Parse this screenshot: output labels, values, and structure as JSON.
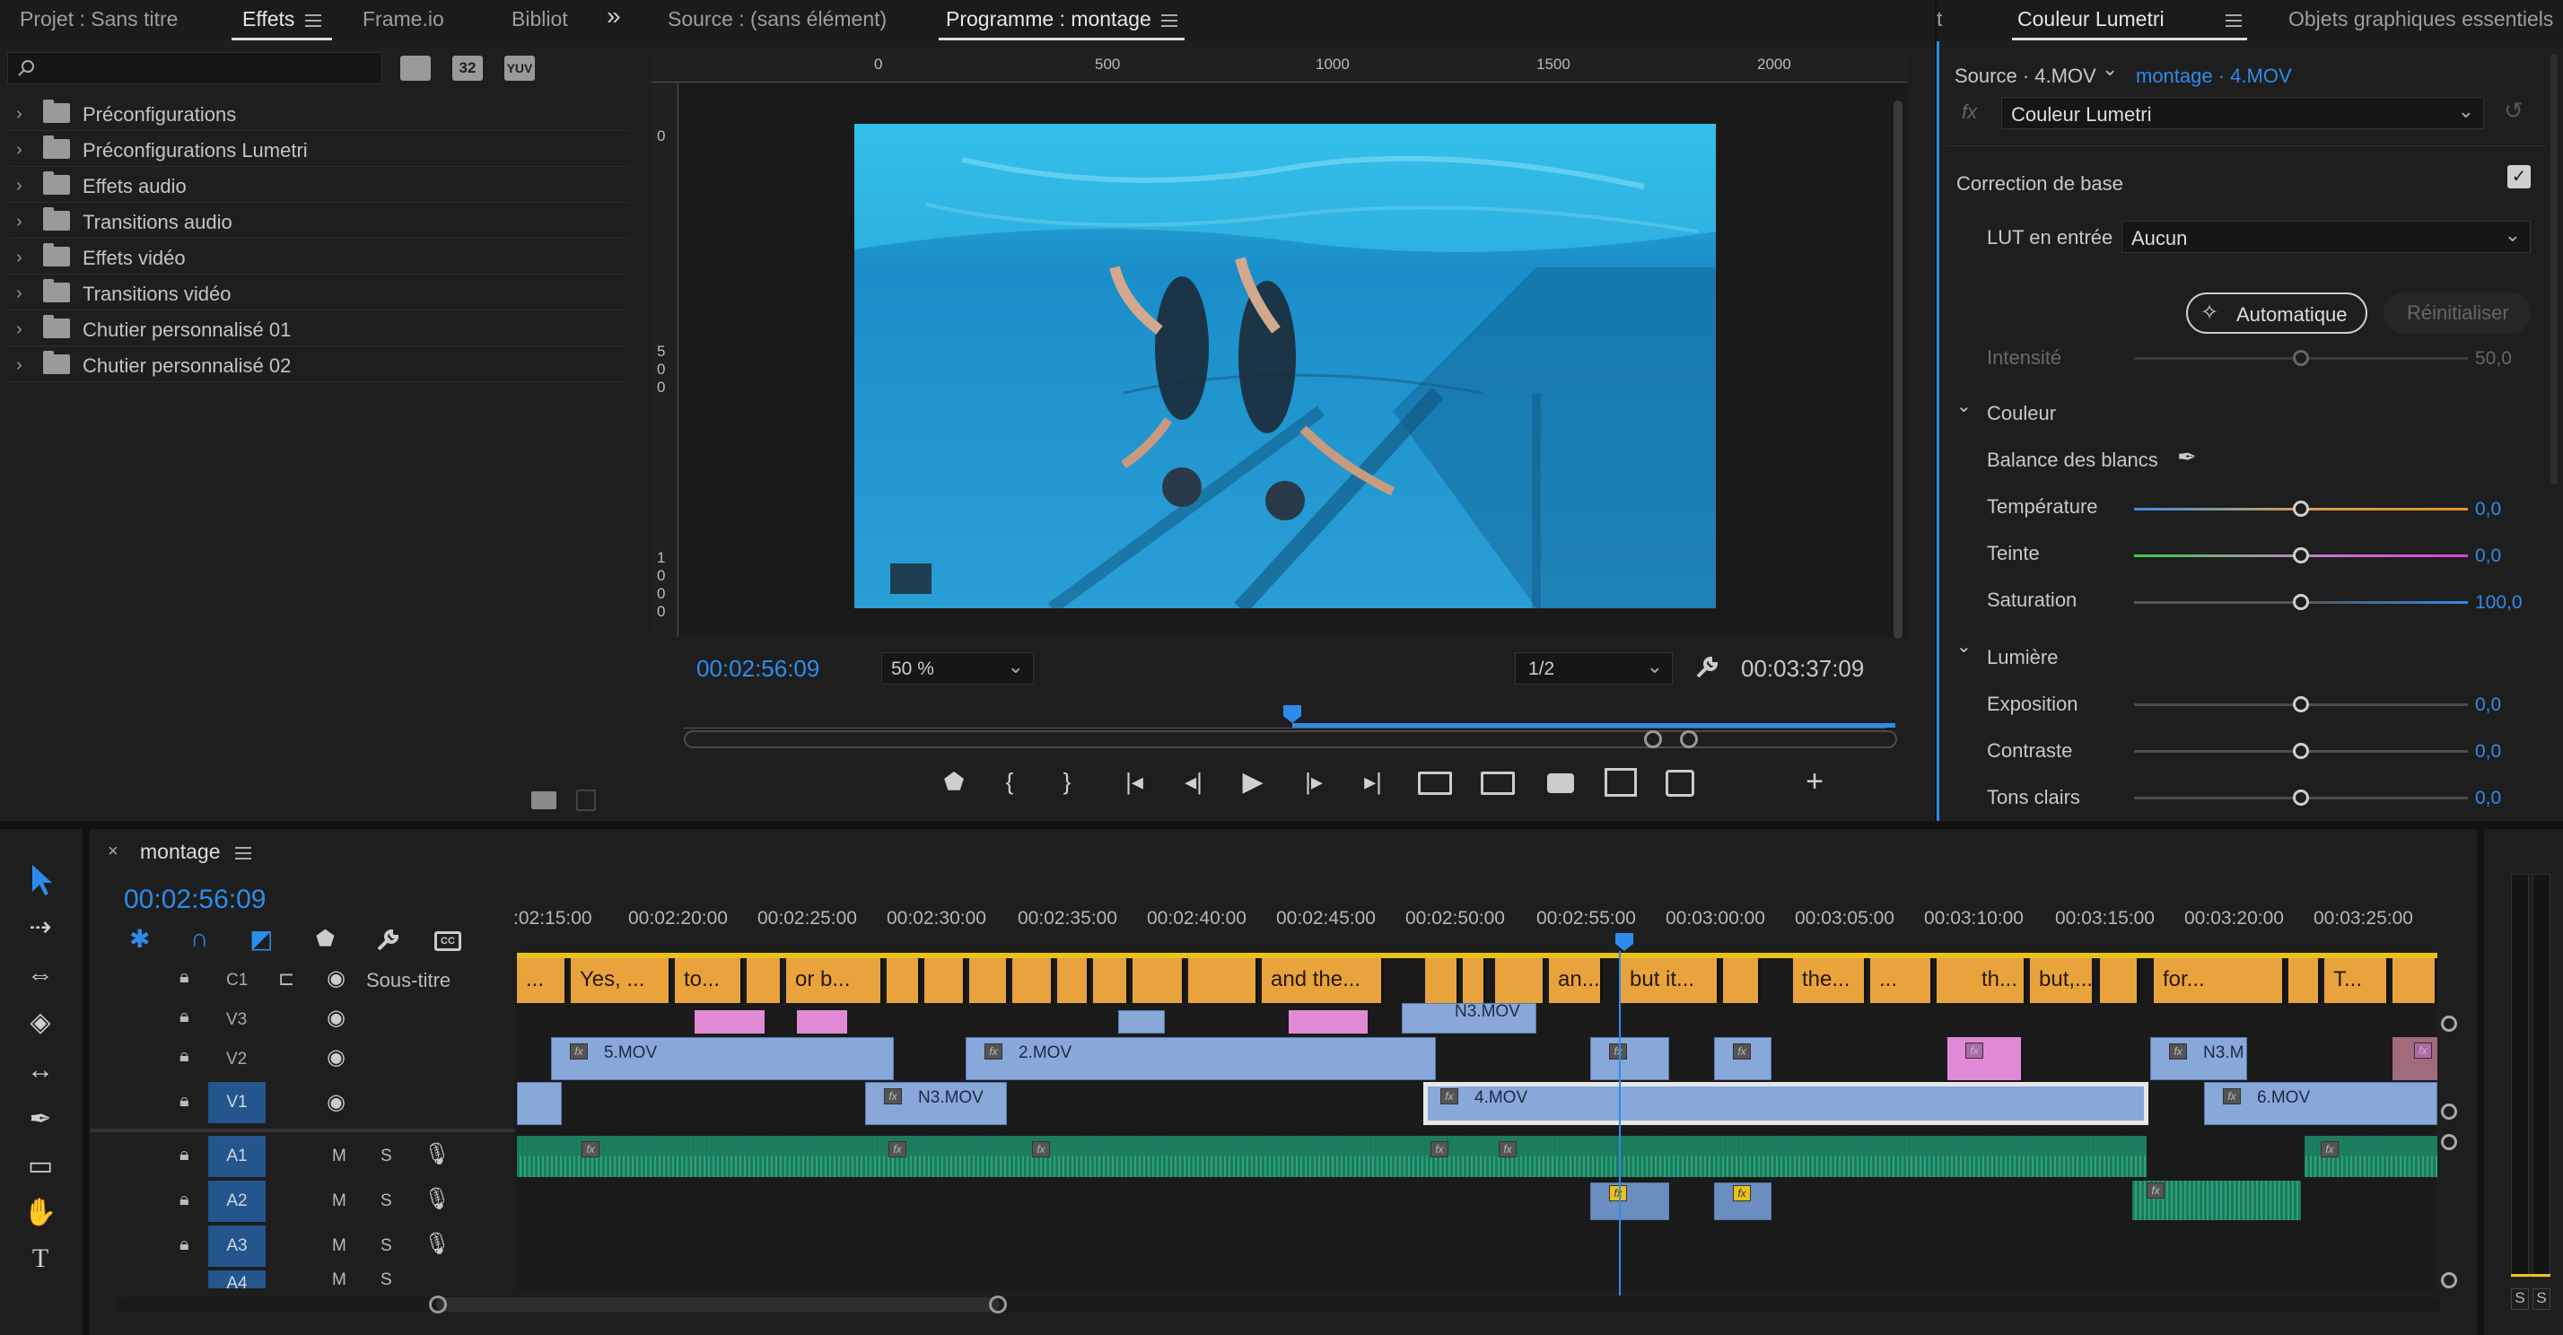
{
  "left_panel": {
    "tabs": [
      "Projet : Sans titre",
      "Effets",
      "Frame.io",
      "Bibliot"
    ],
    "active_tab": "Effets",
    "search_placeholder": "",
    "filter_icons": [
      "32",
      "YUV"
    ],
    "folders": [
      "Préconfigurations",
      "Préconfigurations Lumetri",
      "Effets audio",
      "Transitions audio",
      "Effets vidéo",
      "Transitions vidéo",
      "Chutier personnalisé 01",
      "Chutier personnalisé 02"
    ]
  },
  "monitor": {
    "source_tab": "Source : (sans élément)",
    "program_tab": "Programme : montage",
    "ruler_top": [
      "0",
      "500",
      "1000",
      "1500",
      "2000"
    ],
    "ruler_left": [
      "0",
      "5\n0\n0",
      "1\n0\n0\n0"
    ],
    "current_tc": "00:02:56:09",
    "zoom": "50 %",
    "resolution": "1/2",
    "duration_tc": "00:03:37:09",
    "playhead_fraction": 0.49
  },
  "lumetri": {
    "tab_partial": "t",
    "tabs": [
      "Couleur Lumetri",
      "Objets graphiques essentiels"
    ],
    "source": "Source · 4.MOV",
    "target": "montage · 4.MOV",
    "effect": "Couleur Lumetri",
    "fx": "fx",
    "basic": "Correction de base",
    "lut_label": "LUT en entrée",
    "lut_value": "Aucun",
    "auto_btn": "Automatique",
    "reset_btn": "Réinitialiser",
    "intensity_label": "Intensité",
    "intensity_value": "50,0",
    "color_section": "Couleur",
    "wb_label": "Balance des blancs",
    "temp_label": "Température",
    "temp_value": "0,0",
    "tint_label": "Teinte",
    "tint_value": "0,0",
    "sat_label": "Saturation",
    "sat_value": "100,0",
    "light_section": "Lumière",
    "exp_label": "Exposition",
    "exp_value": "0,0",
    "con_label": "Contraste",
    "con_value": "0,0",
    "hi_label": "Tons clairs",
    "hi_value": "0,0"
  },
  "timeline": {
    "seq_name": "montage",
    "current_tc": "00:02:56:09",
    "ticks": [
      ":02:15:00",
      "00:02:20:00",
      "00:02:25:00",
      "00:02:30:00",
      "00:02:35:00",
      "00:02:40:00",
      "00:02:45:00",
      "00:02:50:00",
      "00:02:55:00",
      "00:03:00:00",
      "00:03:05:00",
      "00:03:10:00",
      "00:03:15:00",
      "00:03:20:00",
      "00:03:25:00"
    ],
    "caption_track_label": "Sous-titre",
    "c1": "C1",
    "tracks_video": [
      "V3",
      "V2",
      "V1"
    ],
    "tracks_audio": [
      "A1",
      "A2",
      "A3",
      "A4"
    ],
    "m_label": "M",
    "s_label": "S",
    "captions": [
      "...",
      "Yes, ...",
      "to...",
      "or b...",
      "and the...",
      "an...",
      "but it...",
      "the...",
      "...",
      "th...",
      "but,...",
      "for...",
      "T..."
    ],
    "v3_clip": "N3.MOV",
    "v2_clips": [
      "5.MOV",
      "2.MOV",
      "N3.M"
    ],
    "v1_clips": [
      "N3.MOV",
      "4.MOV",
      "6.MOV"
    ],
    "meter_labels": [
      "S",
      "S"
    ]
  },
  "colors": {
    "accent": "#2d8ceb",
    "caption": "#e8a33c",
    "video_clip": "#87a8d9",
    "audio_clip": "#1d7a5d",
    "adjust_clip": "#e08ad6"
  }
}
